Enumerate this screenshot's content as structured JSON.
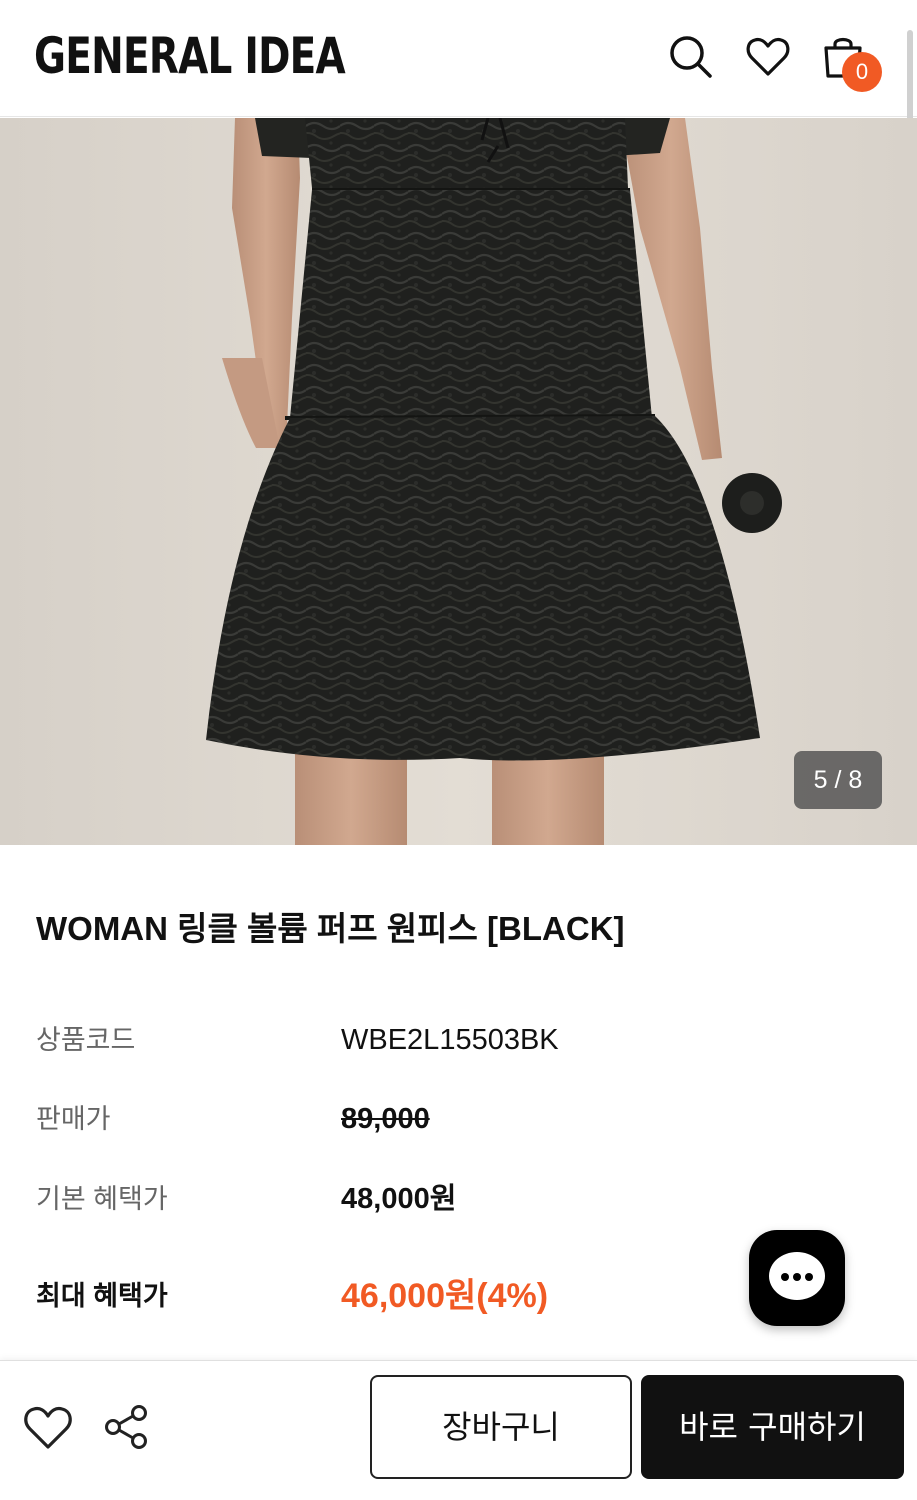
{
  "header": {
    "logo": "GENERAL IDEA",
    "icons": [
      "search-icon",
      "heart-icon",
      "shopping-bag-icon"
    ],
    "cart_count": "0"
  },
  "gallery": {
    "current": 5,
    "total": 8,
    "pager_text": "5 / 8"
  },
  "product": {
    "title": "WOMAN 링클 볼륨 퍼프 원피스 [BLACK]",
    "rows": [
      {
        "label": "상품코드",
        "value": "WBE2L15503BK"
      },
      {
        "label": "판매가",
        "value": "89,000"
      },
      {
        "label": "기본 혜택가",
        "value": "48,000원"
      },
      {
        "label": "최대 혜택가",
        "value": "46,000원(4%)"
      }
    ]
  },
  "bottom_bar": {
    "icons": [
      "heart-icon",
      "share-icon"
    ],
    "cart_label": "장바구니",
    "buy_label": "바로 구매하기"
  },
  "colors": {
    "accent": "#f15a24",
    "primary_button": "#111111",
    "text_muted": "#666666"
  }
}
